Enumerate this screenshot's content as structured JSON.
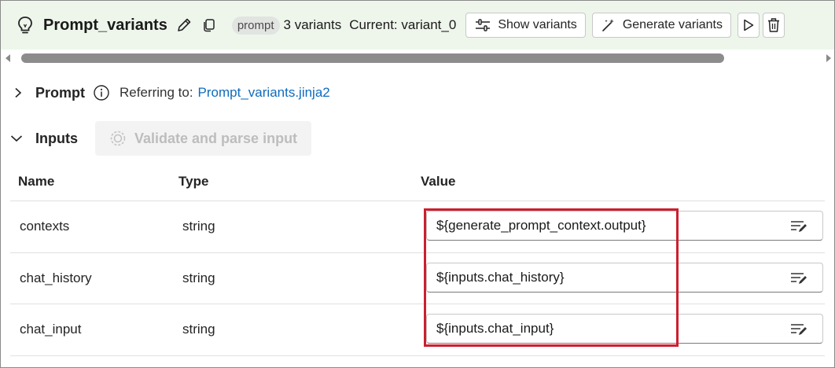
{
  "header": {
    "title": "Prompt_variants",
    "tag": "prompt",
    "variant_count": "3 variants",
    "current_variant": "Current: variant_0",
    "show_variants_label": "Show variants",
    "generate_variants_label": "Generate variants"
  },
  "prompt": {
    "label": "Prompt",
    "referring_label": "Referring to:",
    "referring_link": "Prompt_variants.jinja2"
  },
  "inputs": {
    "label": "Inputs",
    "validate_label": "Validate and parse input",
    "columns": {
      "name": "Name",
      "type": "Type",
      "value": "Value"
    },
    "rows": [
      {
        "name": "contexts",
        "type": "string",
        "value": "${generate_prompt_context.output}"
      },
      {
        "name": "chat_history",
        "type": "string",
        "value": "${inputs.chat_history}"
      },
      {
        "name": "chat_input",
        "type": "string",
        "value": "${inputs.chat_input}"
      }
    ]
  },
  "colors": {
    "header_bg": "#eef6ec",
    "link": "#0f6cbd",
    "highlight": "#cc1f2f"
  }
}
